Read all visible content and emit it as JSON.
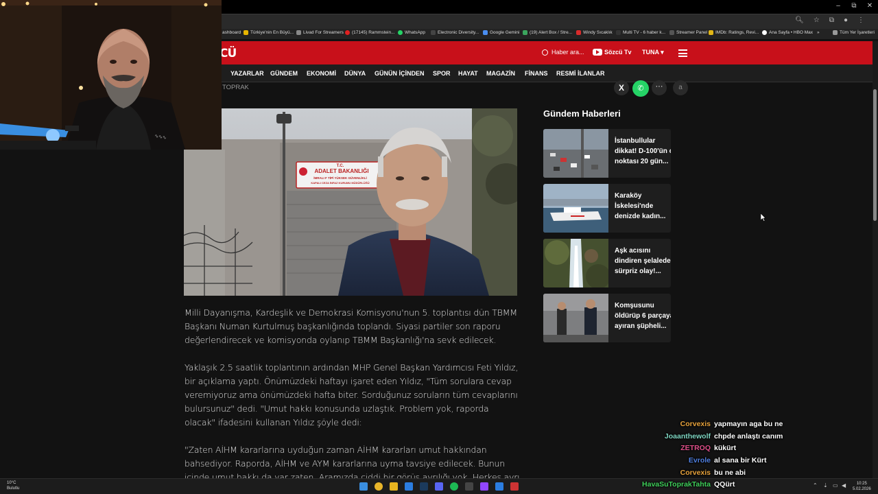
{
  "browser": {
    "bookmarks": [
      "ashboard",
      "Türkiye'nin En Büyü...",
      "Livad For Streamers",
      "(17145) Rammstein...",
      "WhatsApp",
      "Electronic Diversity...",
      "Google Gemini",
      "(19) Alert Box / Stre...",
      "Windy Sıcaklık",
      "Multi TV - 6 haber k...",
      "Streamer Panel",
      "IMDb: Ratings, Revi...",
      "Ana Sayfa • HBO Max",
      "»",
      "Tüm Yer İşaretleri"
    ],
    "window_controls": [
      "–",
      "⧉",
      "✕"
    ]
  },
  "site": {
    "logo": "CÜ",
    "search_placeholder": "Haber ara...",
    "tv_label": "Sözcü Tv",
    "user_label": "TUNA ▾",
    "nav": [
      "YAZARLAR",
      "GÜNDEM",
      "EKONOMİ",
      "DÜNYA",
      "GÜNÜN İÇİNDEN",
      "SPOR",
      "HAYAT",
      "MAGAZİN",
      "FİNANS",
      "RESMİ İLANLAR"
    ]
  },
  "article": {
    "author_fragment": "TOPRAK",
    "image_sign": {
      "line1": "T.C.",
      "line2": "ADALET BAKANLIĞI",
      "line3": "İMRALI F TİPİ YÜKSEK GÜVENLİKLİ",
      "line4": "KAPALI CEZA İNFAZ KURUMU MÜDÜRLÜĞÜ"
    },
    "paragraphs": [
      "Milli Dayanışma, Kardeşlik ve Demokrasi Komisyonu'nun 5. toplantısı dün TBMM Başkanı Numan Kurtulmuş başkanlığında toplandı. Siyasi partiler son raporu değerlendirecek ve komisyonda oylanıp TBMM Başkanlığı'na sevk edilecek.",
      "Yaklaşık 2.5 saatlik toplantının ardından MHP Genel Başkan Yardımcısı Feti Yıldız, bir açıklama yaptı. Önümüzdeki haftayı işaret eden Yıldız, \"Tüm sorulara cevap veremiyoruz ama önümüzdeki hafta biter. Sorduğunuz soruların tüm cevaplarını bulursunuz\" dedi. \"Umut hakkı konusunda uzlaştık. Problem yok, raporda olacak\" ifadesini kullanan Yıldız şöyle dedi:",
      "\"Zaten AİHM kararlarına uyduğun zaman AİHM kararları umut hakkından bahsediyor. Raporda, AİHM ve AYM kararlarına uyma tavsiye edilecek. Bunun içinde umut hakkı da var zaten. Aramızda ciddi bir görüş ayrılığı yok. Herkes ayrı siyasi parti noktasında talepler"
    ]
  },
  "sidebar": {
    "title": "Gündem Haberleri",
    "items": [
      {
        "text": "İstanbullular dikkat! D-100'ün o noktası 20 gün...",
        "thumb_color": "#7d8a96"
      },
      {
        "text": "Karaköy İskelesi'nde denizde kadın...",
        "thumb_color": "#6f8aa0"
      },
      {
        "text": "Aşk acısını dindiren şelalede sürpriz olay!...",
        "thumb_color": "#4d5a3a"
      },
      {
        "text": "Komşusunu öldürüp 6 parçaya ayıran şüpheli...",
        "thumb_color": "#5a5c60"
      }
    ]
  },
  "chat": [
    {
      "user": "Corvexis",
      "msg": "yapmayın aga bu ne",
      "color": "#e8a33c"
    },
    {
      "user": "Joaanthewolf",
      "msg": "chpde anlaştı canım",
      "color": "#7fd6c2"
    },
    {
      "user": "ZETROQ",
      "msg": "kükürt",
      "color": "#e0508a"
    },
    {
      "user": "Evrole",
      "msg": "al sana bir Kürt",
      "color": "#4f7fe0"
    },
    {
      "user": "Corvexis",
      "msg": "bu ne abi",
      "color": "#e8a33c"
    },
    {
      "user": "HavaSuToprakTahta",
      "msg": "QQürt",
      "color": "#3fcf5a"
    }
  ],
  "taskbar": {
    "weather_temp": "10°C",
    "weather_desc": "Bulutlu",
    "time": "10:25",
    "date": "5.02.2026"
  }
}
